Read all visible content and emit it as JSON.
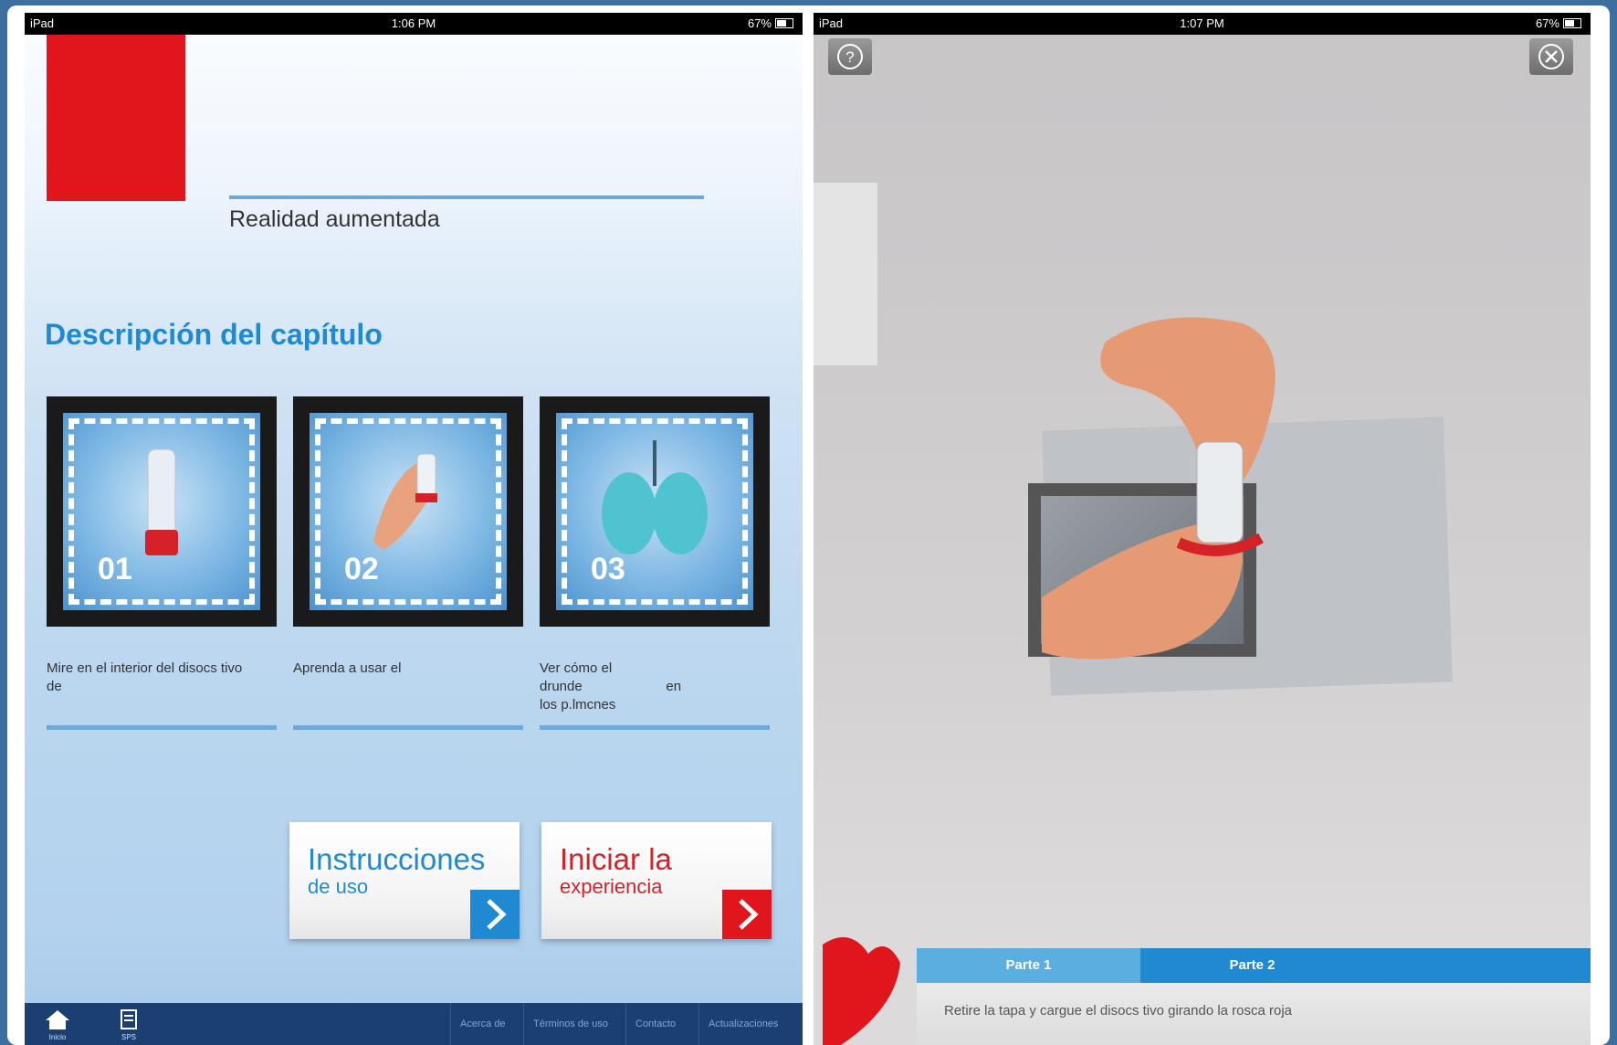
{
  "left_screen": {
    "status_bar": {
      "device": "iPad",
      "time": "1:06 PM",
      "battery": "67%"
    },
    "subtitle": "Realidad aumentada",
    "section_title": "Descripción del capítulo",
    "cards": [
      {
        "number": "01",
        "caption": "Mire en el interior del disocs tivo\nde"
      },
      {
        "number": "02",
        "caption": "Aprenda a usar el"
      },
      {
        "number": "03",
        "caption": "Ver cómo el\ndrunde                      en\nlos p.lmcnes"
      }
    ],
    "buttons": {
      "instructions": {
        "line1": "Instrucciones",
        "line2": "de uso"
      },
      "start": {
        "line1": "Iniciar la",
        "line2": "experiencia"
      }
    },
    "bottom_nav": {
      "home_label": "Inicio",
      "second_label": "SPS",
      "links": [
        "Acerca de",
        "Términos de uso",
        "Contacto",
        "Actualizaciones"
      ]
    },
    "colors": {
      "accent_blue": "#1f8ad1",
      "brand_red": "#e1161c",
      "nav_dark": "#1c3f72"
    }
  },
  "right_screen": {
    "status_bar": {
      "device": "iPad",
      "time": "1:07 PM",
      "battery": "67%"
    },
    "help_icon": "question-circle-icon",
    "close_icon": "close-circle-icon",
    "tabs": [
      "Parte 1",
      "Parte 2"
    ],
    "instruction": "Retire la tapa y cargue el disocs tivo girando la rosca roja"
  }
}
